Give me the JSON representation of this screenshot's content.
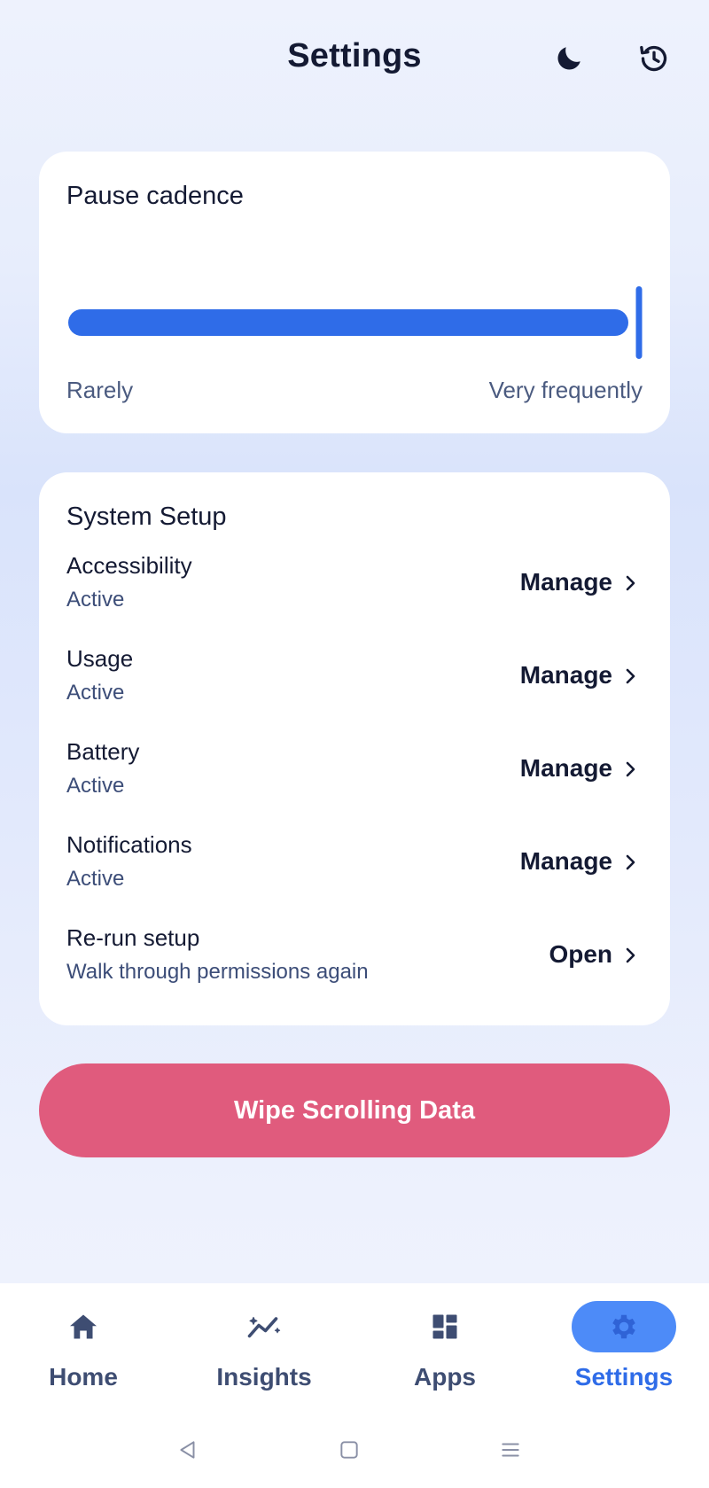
{
  "header": {
    "title": "Settings",
    "icons": [
      "moon-icon",
      "history-icon"
    ]
  },
  "pause_cadence": {
    "title": "Pause cadence",
    "min_label": "Rarely",
    "max_label": "Very frequently",
    "value_fraction": 1.0
  },
  "system_setup": {
    "title": "System Setup",
    "items": [
      {
        "title": "Accessibility",
        "status": "Active",
        "action": "Manage"
      },
      {
        "title": "Usage",
        "status": "Active",
        "action": "Manage"
      },
      {
        "title": "Battery",
        "status": "Active",
        "action": "Manage"
      },
      {
        "title": "Notifications",
        "status": "Active",
        "action": "Manage"
      },
      {
        "title": "Re-run setup",
        "status": "Walk through permissions again",
        "action": "Open"
      }
    ]
  },
  "wipe_button": {
    "label": "Wipe Scrolling Data"
  },
  "nav": {
    "items": [
      {
        "label": "Home",
        "icon": "home-icon"
      },
      {
        "label": "Insights",
        "icon": "insights-icon"
      },
      {
        "label": "Apps",
        "icon": "apps-icon"
      },
      {
        "label": "Settings",
        "icon": "gear-icon"
      }
    ],
    "active": "Settings"
  },
  "colors": {
    "accent": "#2f6ce8",
    "danger": "#e05b7d",
    "nav_active_bg": "#4d8bf8",
    "text_primary": "#141a33",
    "text_secondary": "#3c4d78"
  }
}
